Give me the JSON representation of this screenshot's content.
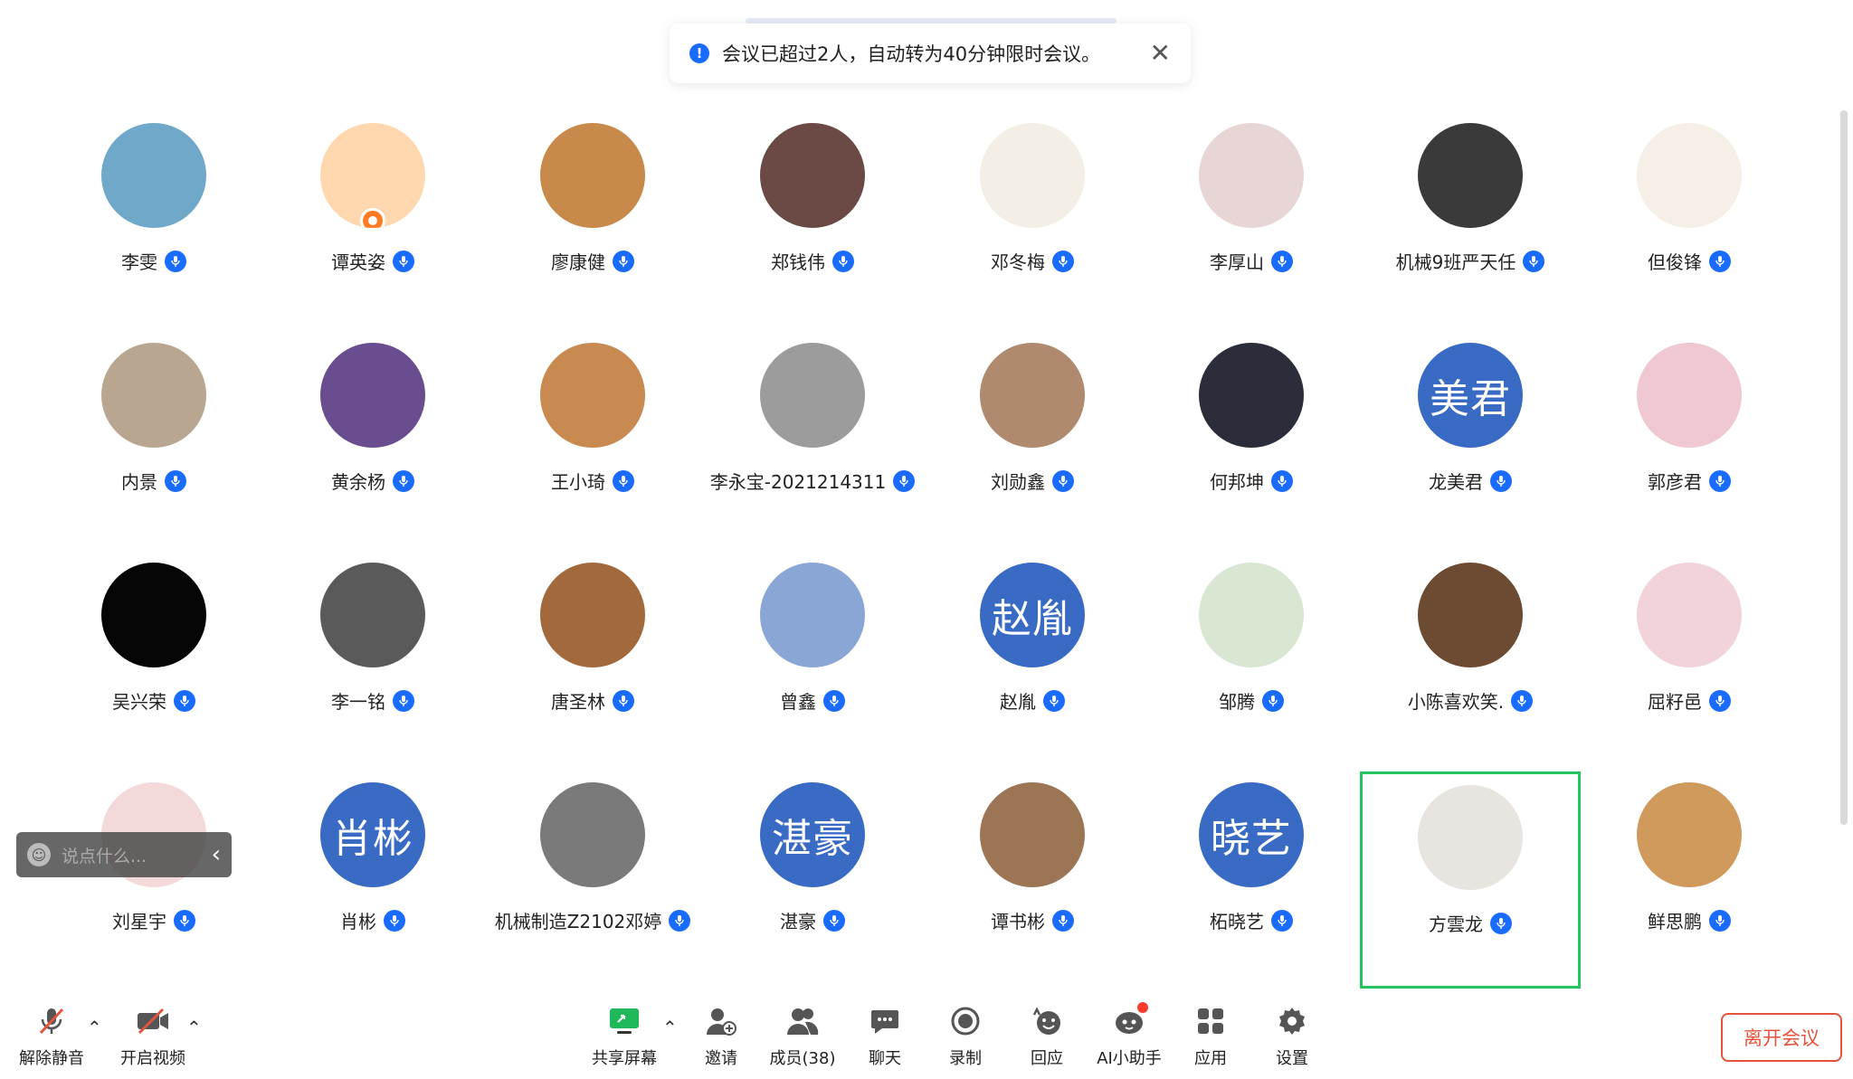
{
  "notice": {
    "message": "会议已超过2人，自动转为40分钟限时会议。",
    "close_icon": "close-icon"
  },
  "participants": [
    {
      "name": "李雯",
      "avatar": "#6fa8c9"
    },
    {
      "name": "谭英姿",
      "avatar": "#ffd8b0",
      "badge": true
    },
    {
      "name": "廖康健",
      "avatar": "#c88a4a"
    },
    {
      "name": "郑钱伟",
      "avatar": "#6b4a45"
    },
    {
      "name": "邓冬梅",
      "avatar": "#f4efe6"
    },
    {
      "name": "李厚山",
      "avatar": "#e8d6d6"
    },
    {
      "name": "机械9班严天任",
      "avatar": "#3a3a3a"
    },
    {
      "name": "但俊锋",
      "avatar": "#f6efe8"
    },
    {
      "name": "内景",
      "avatar": "#b9a690"
    },
    {
      "name": "黄余杨",
      "avatar": "#6a4d8f"
    },
    {
      "name": "王小琦",
      "avatar": "#c98a52"
    },
    {
      "name": "李永宝-2021214311",
      "avatar": "#9c9c9c"
    },
    {
      "name": "刘勋鑫",
      "avatar": "#b08a6e"
    },
    {
      "name": "何邦坤",
      "avatar": "#2b2d3a"
    },
    {
      "name": "龙美君",
      "avatar": "text",
      "initials": "美君"
    },
    {
      "name": "郭彦君",
      "avatar": "#efc8d2"
    },
    {
      "name": "吴兴荣",
      "avatar": "#050505"
    },
    {
      "name": "李一铭",
      "avatar": "#5a5a5a"
    },
    {
      "name": "唐圣林",
      "avatar": "#a26a3c"
    },
    {
      "name": "曾鑫",
      "avatar": "#8aa6d4"
    },
    {
      "name": "赵胤",
      "avatar": "text",
      "initials": "赵胤"
    },
    {
      "name": "邹腾",
      "avatar": "#d9e6d2"
    },
    {
      "name": "小陈喜欢笑.",
      "avatar": "#6d4a32"
    },
    {
      "name": "屈籽邑",
      "avatar": "#f2d3da"
    },
    {
      "name": "刘星宇",
      "avatar": "#f3d9d9"
    },
    {
      "name": "肖彬",
      "avatar": "text",
      "initials": "肖彬"
    },
    {
      "name": "机械制造Z2102邓婷",
      "avatar": "#7a7a7a"
    },
    {
      "name": "湛豪",
      "avatar": "text",
      "initials": "湛豪"
    },
    {
      "name": "谭书彬",
      "avatar": "#9c7654"
    },
    {
      "name": "柘晓艺",
      "avatar": "text",
      "initials": "晓艺"
    },
    {
      "name": "方雲龙",
      "avatar": "#e8e4df",
      "active": true
    },
    {
      "name": "鲜思鹏",
      "avatar": "#d09a5c"
    }
  ],
  "chat_bubble": {
    "placeholder": "说点什么..."
  },
  "toolbar": {
    "unmute": "解除静音",
    "start_video": "开启视频",
    "share_screen": "共享屏幕",
    "invite": "邀请",
    "members": "成员(38)",
    "chat": "聊天",
    "record": "录制",
    "reactions": "回应",
    "ai_assistant": "AI小助手",
    "apps": "应用",
    "settings": "设置",
    "leave": "离开会议"
  },
  "colors": {
    "accent": "#1a6bff",
    "text_avatar": "#3a6bc4",
    "active_border": "#22c55e",
    "leave": "#e5533d",
    "share_green": "#1fb85a"
  }
}
